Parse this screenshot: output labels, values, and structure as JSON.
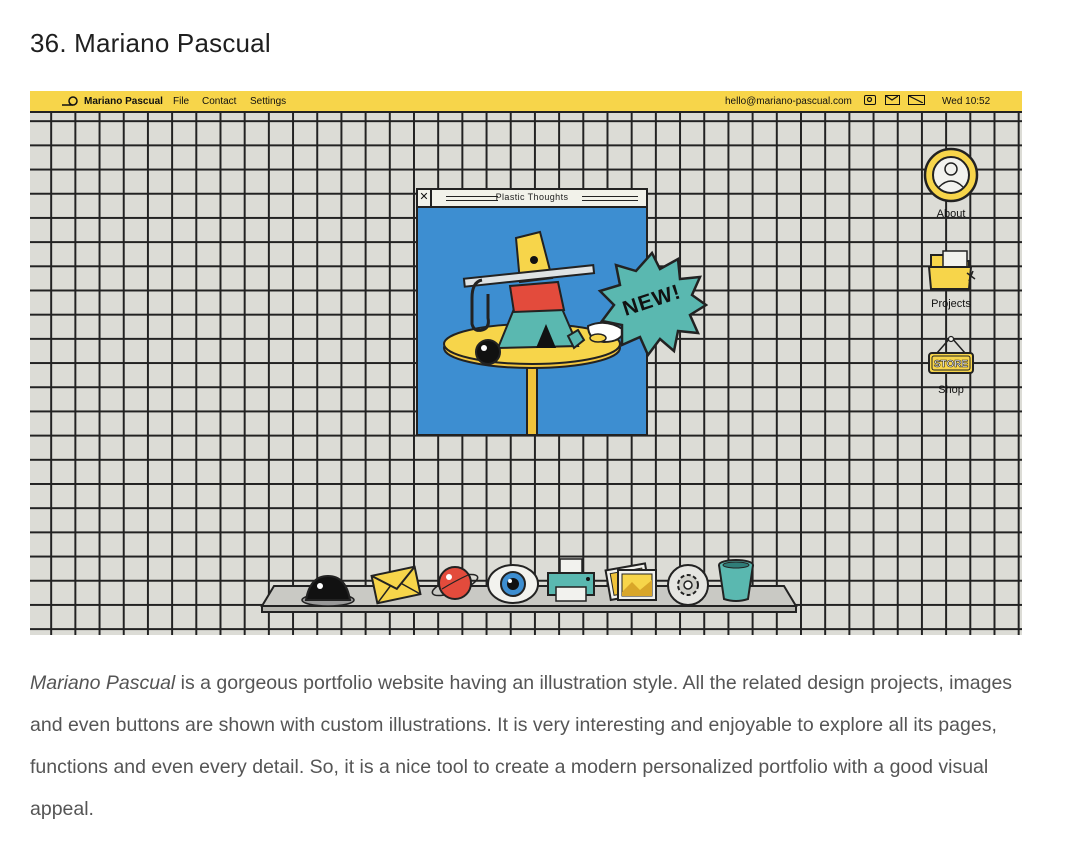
{
  "article": {
    "title": "36. Mariano Pascual",
    "body_lead": "Mariano Pascual",
    "body_rest": " is a gorgeous portfolio website having an illustration style. All the related design projects, images and even buttons are shown with custom illustrations. It is very interesting and enjoyable to explore all its pages, functions and even every detail. So, it is a nice tool to create a modern personalized portfolio with a good visual appeal."
  },
  "site": {
    "menubar": {
      "brand": "Mariano Pascual",
      "menu": [
        "File",
        "Contact",
        "Settings"
      ],
      "email": "hello@mariano-pascual.com",
      "clock": "Wed 10:52",
      "status_icons": [
        "instagram-icon",
        "mail-icon",
        "battery-icon"
      ]
    },
    "window": {
      "title": "Plastic Thoughts",
      "badge": "NEW!"
    },
    "desktop_icons": [
      {
        "label": "About",
        "icon": "avatar-icon"
      },
      {
        "label": "Projects",
        "icon": "folder-icon"
      },
      {
        "label": "Shop",
        "icon": "store-sign-icon",
        "sign_text": "STORE"
      }
    ],
    "dock_icons": [
      "black-dome-icon",
      "envelope-icon",
      "planet-icon",
      "eye-icon",
      "printer-icon",
      "photos-icon",
      "gear-icon",
      "trash-bin-icon"
    ]
  },
  "colors": {
    "menubar": "#f7d54a",
    "grid_bg": "#dcdcd6",
    "window_bg": "#3d8ed1",
    "badge": "#5ab8b0",
    "ink": "#222222"
  }
}
